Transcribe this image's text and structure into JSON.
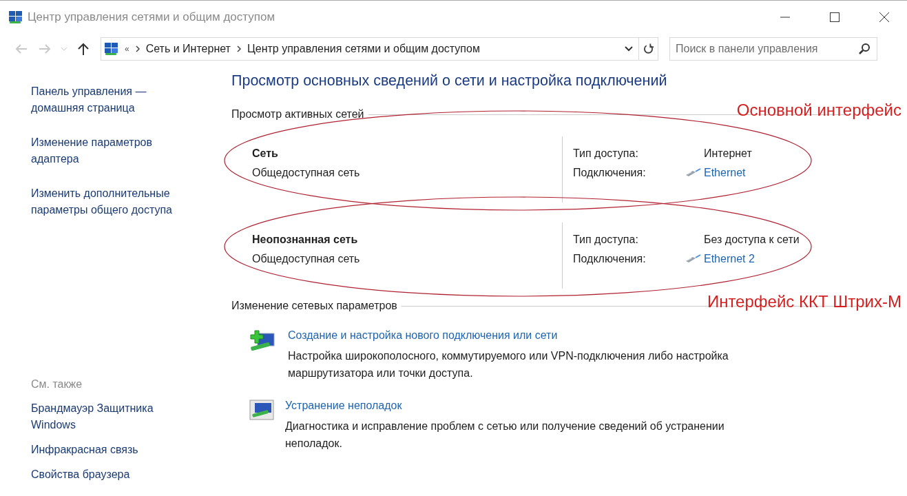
{
  "window": {
    "title": "Центр управления сетями и общим доступом"
  },
  "address_bar": {
    "overflow": "«",
    "breadcrumbs": [
      "Сеть и Интернет",
      "Центр управления сетями и общим доступом"
    ]
  },
  "search": {
    "placeholder": "Поиск в панели управления"
  },
  "sidebar": {
    "links": [
      "Панель управления — домашняя страница",
      "Изменение параметров адаптера",
      "Изменить дополнительные параметры общего доступа"
    ],
    "see_also_title": "См. также",
    "see_also": [
      "Брандмауэр Защитника Windows",
      "Инфракрасная связь",
      "Свойства браузера"
    ]
  },
  "heading": "Просмотр основных сведений о сети и настройка подключений",
  "active_networks": {
    "title": "Просмотр активных сетей",
    "annotation": "Основной интерфейс",
    "networks": [
      {
        "name": "Сеть",
        "category": "Общедоступная сеть",
        "access_label": "Тип доступа:",
        "access": "Интернет",
        "connections_label": "Подключения:",
        "connection": "Ethernet",
        "circled": true
      },
      {
        "name": "Неопознанная сеть",
        "category": "Общедоступная сеть",
        "access_label": "Тип доступа:",
        "access": "Без доступа к сети",
        "connections_label": "Подключения:",
        "connection": "Ethernet 2",
        "circled": true
      }
    ]
  },
  "change_settings": {
    "title": "Изменение сетевых параметров",
    "annotation": "Интерфейс ККТ Штрих-М",
    "tasks": [
      {
        "kind": "new",
        "link": "Создание и настройка нового подключения или сети",
        "description": "Настройка широкополосного, коммутируемого или VPN-подключения либо настройка маршрутизатора или точки доступа."
      },
      {
        "kind": "troubleshoot",
        "link": "Устранение неполадок",
        "description": "Диагностика и исправление проблем с сетью или получение сведений об устранении неполадок."
      }
    ]
  }
}
